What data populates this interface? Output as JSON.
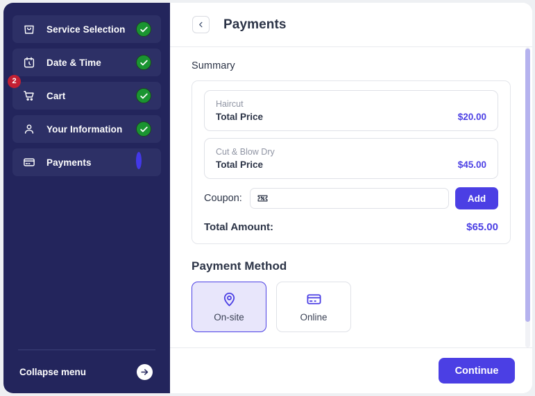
{
  "sidebar": {
    "items": [
      {
        "label": "Service Selection",
        "icon": "shopping-bag-icon",
        "state": "complete",
        "badge": null
      },
      {
        "label": "Date & Time",
        "icon": "calendar-clock-icon",
        "state": "complete",
        "badge": null
      },
      {
        "label": "Cart",
        "icon": "shopping-cart-icon",
        "state": "complete",
        "badge": "2"
      },
      {
        "label": "Your Information",
        "icon": "user-icon",
        "state": "complete",
        "badge": null
      },
      {
        "label": "Payments",
        "icon": "credit-card-icon",
        "state": "active",
        "badge": null
      }
    ],
    "collapse_label": "Collapse menu",
    "background_color": "#23255c",
    "item_background_color": "#2d3066",
    "badge_color": "#c32033",
    "complete_color": "#1a9431",
    "active_ring_color": "#4338e8"
  },
  "header": {
    "title": "Payments",
    "back_icon": "chevron-left-icon"
  },
  "summary": {
    "section_title": "Summary",
    "items": [
      {
        "name": "Haircut",
        "price_label": "Total Price",
        "price": "$20.00"
      },
      {
        "name": "Cut & Blow Dry",
        "price_label": "Total Price",
        "price": "$45.00"
      }
    ],
    "coupon_label": "Coupon:",
    "coupon_value": "",
    "coupon_placeholder": "",
    "coupon_icon": "ticket-percent-icon",
    "add_label": "Add",
    "total_label": "Total Amount:",
    "total_value": "$65.00",
    "accent_color": "#4b3fe4"
  },
  "payment_method": {
    "section_title": "Payment Method",
    "options": [
      {
        "label": "On-site",
        "icon": "map-pin-icon",
        "selected": true
      },
      {
        "label": "Online",
        "icon": "credit-card-icon",
        "selected": false
      }
    ]
  },
  "footer": {
    "continue_label": "Continue"
  }
}
